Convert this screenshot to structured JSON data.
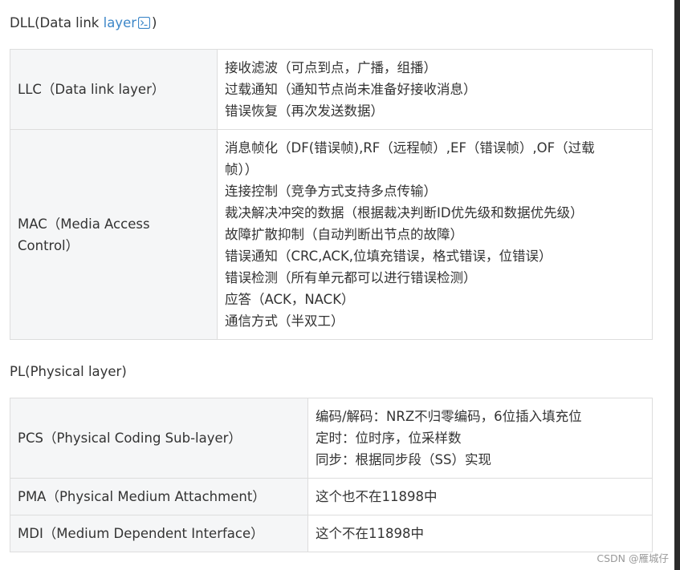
{
  "dll": {
    "heading_prefix": "DLL(Data link ",
    "heading_link": "layer",
    "heading_suffix": ")",
    "rows": [
      {
        "key": "LLC（Data link layer）",
        "lines": [
          "接收滤波（可点到点，广播，组播）",
          "过载通知（通知节点尚未准备好接收消息）",
          "错误恢复（再次发送数据）"
        ]
      },
      {
        "key_lines": [
          "MAC（Media Access",
          "Control）"
        ],
        "lines": [
          "消息帧化（DF(错误帧),RF（远程帧）,EF（错误帧）,OF（过载",
          "帧））",
          "连接控制（竞争方式支持多点传输）",
          "裁决解决冲突的数据（根据裁决判断ID优先级和数据优先级）",
          "故障扩散抑制（自动判断出节点的故障）",
          "错误通知（CRC,ACK,位填充错误，格式错误，位错误）",
          "错误检测（所有单元都可以进行错误检测）",
          "应答（ACK，NACK）",
          "通信方式（半双工）"
        ]
      }
    ]
  },
  "pl": {
    "heading": "PL(Physical layer)",
    "rows": [
      {
        "key": "PCS（Physical Coding Sub-layer）",
        "lines": [
          "编码/解码：NRZ不归零编码，6位插入填充位",
          "定时：位时序，位采样数",
          "同步：根据同步段（SS）实现"
        ]
      },
      {
        "key": "PMA（Physical Medium Attachment）",
        "lines": [
          "这个也不在11898中"
        ]
      },
      {
        "key": "MDI（Medium Dependent Interface）",
        "lines": [
          "这个不在11898中"
        ]
      }
    ]
  },
  "watermark": "CSDN @雁城仔",
  "colors": {
    "link": "#3d87c8",
    "border": "#dddddd",
    "key_background": "#f5f6f7",
    "text": "#333333"
  },
  "icons": {
    "link_icon": "search-icon"
  }
}
